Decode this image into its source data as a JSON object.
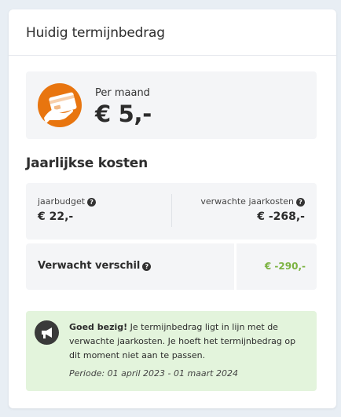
{
  "header": {
    "title": "Huidig termijnbedrag"
  },
  "monthly": {
    "label": "Per maand",
    "value": "€ 5,-",
    "icon": "card-in-hand-icon",
    "icon_color": "#e8750f"
  },
  "yearly": {
    "title": "Jaarlijkse kosten",
    "budget_label": "jaarbudget",
    "budget_value": "€ 22,-",
    "expected_label": "verwachte jaarkosten",
    "expected_value": "€ -268,-",
    "help_symbol": "?"
  },
  "difference": {
    "label": "Verwacht verschil",
    "value": "€ -290,-",
    "value_color": "#7cb342"
  },
  "notice": {
    "icon": "megaphone-icon",
    "bold": "Goed bezig!",
    "text": " Je termijnbedrag ligt in lijn met de verwachte jaarkosten. Je hoeft het termijnbedrag op dit moment niet aan te passen.",
    "period": "Periode: 01 april 2023 - 01 maart 2024",
    "background": "#e3f4dc"
  }
}
